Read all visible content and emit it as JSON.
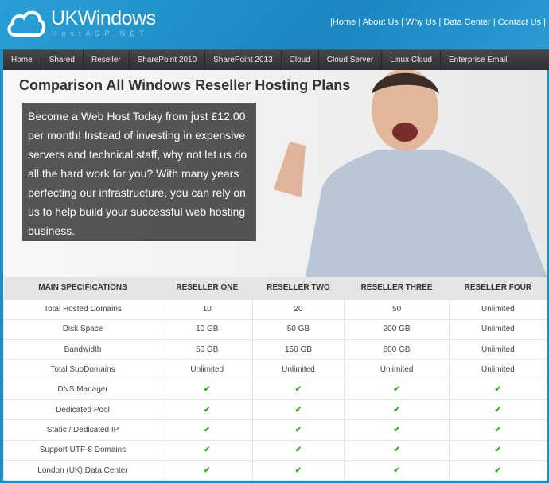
{
  "brand": {
    "title": "UKWindows",
    "subtitle": "HostASP.NET"
  },
  "top_links": [
    "Home",
    "About Us",
    "Why Us",
    "Data Center",
    "Contact Us"
  ],
  "nav": [
    "Home",
    "Shared",
    "Reseller",
    "SharePoint 2010",
    "SharePoint 2013",
    "Cloud",
    "Cloud Server",
    "Linux Cloud",
    "Enterprise Email"
  ],
  "hero": {
    "title": "Comparison All Windows Reseller Hosting Plans",
    "promo": "Become a Web Host Today from just £12.00 per month! Instead of investing in expensive servers and technical staff, why not let us do all the hard work for you? With many years perfecting our infrastructure, you can rely on us to help build your successful web hosting business."
  },
  "table": {
    "headers": [
      "MAIN SPECIFICATIONS",
      "RESELLER ONE",
      "RESELLER TWO",
      "RESELLER THREE",
      "RESELLER FOUR"
    ],
    "rows": [
      [
        "Total Hosted Domains",
        "10",
        "20",
        "50",
        "Unlimited"
      ],
      [
        "Disk Space",
        "10 GB",
        "50 GB",
        "200 GB",
        "Unlimited"
      ],
      [
        "Bandwidth",
        "50 GB",
        "150 GB",
        "500 GB",
        "Unlimited"
      ],
      [
        "Total SubDomains",
        "Unlimited",
        "Unlimited",
        "Unlimited",
        "Unlimited"
      ],
      [
        "DNS Manager",
        "✔",
        "✔",
        "✔",
        "✔"
      ],
      [
        "Dedicated Pool",
        "✔",
        "✔",
        "✔",
        "✔"
      ],
      [
        "Static / Dedicated IP",
        "✔",
        "✔",
        "✔",
        "✔"
      ],
      [
        "Support UTF-8 Domains",
        "✔",
        "✔",
        "✔",
        "✔"
      ],
      [
        "London (UK) Data Center",
        "✔",
        "✔",
        "✔",
        "✔"
      ]
    ]
  },
  "colors": {
    "header_blue": "#1e8fc4",
    "nav_dark": "#3a3b40",
    "check_green": "#2eaa1e"
  }
}
